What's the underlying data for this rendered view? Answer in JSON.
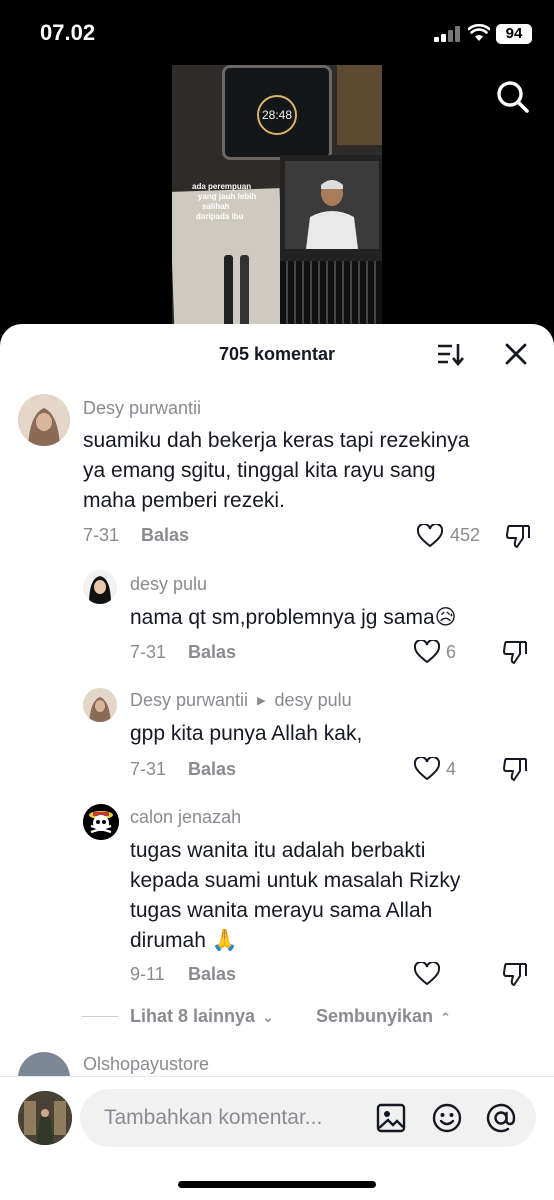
{
  "status_bar": {
    "time": "07.02",
    "battery": "94"
  },
  "video": {
    "clock": "28:48",
    "overlay_lines": [
      "ada perempuan",
      "yang jauh lebih",
      "salihah",
      "daripada ibu"
    ]
  },
  "sheet": {
    "title": "705 komentar"
  },
  "comments": [
    {
      "user": "Desy purwantii",
      "text_lines": [
        "suamiku dah bekerja keras tapi rezekinya",
        "ya emang sgitu, tinggal kita rayu sang",
        "maha pemberi rezeki."
      ],
      "date": "7-31",
      "reply_label": "Balas",
      "likes": "452"
    },
    {
      "user": "desy pulu",
      "text_lines": [
        "nama qt sm,problemnya jg sama😥"
      ],
      "date": "7-31",
      "reply_label": "Balas",
      "likes": "6"
    },
    {
      "user": "Desy purwantii",
      "reply_to": "desy pulu",
      "text_lines": [
        "gpp kita punya Allah kak,"
      ],
      "date": "7-31",
      "reply_label": "Balas",
      "likes": "4"
    },
    {
      "user": "calon jenazah",
      "text_lines": [
        "tugas wanita itu adalah berbakti",
        "kepada suami untuk masalah Rizky",
        "tugas wanita merayu sama Allah",
        "dirumah 🙏"
      ],
      "date": "9-11",
      "reply_label": "Balas",
      "likes": ""
    }
  ],
  "replies_controls": {
    "more_label": "Lihat 8 lainnya",
    "hide_label": "Sembunyikan"
  },
  "next_comment": {
    "user": "Olshopayustore"
  },
  "composer": {
    "placeholder": "Tambahkan komentar..."
  },
  "icons": {
    "search": "search-icon",
    "sort": "sort-icon",
    "close": "close-icon",
    "heart": "heart-icon",
    "dislike": "dislike-icon",
    "image": "image-icon",
    "emoji": "emoji-icon",
    "mention": "at-icon"
  },
  "colors": {
    "text_primary": "#161823",
    "text_secondary": "#8a8b91",
    "sheet_bg": "#ffffff"
  }
}
